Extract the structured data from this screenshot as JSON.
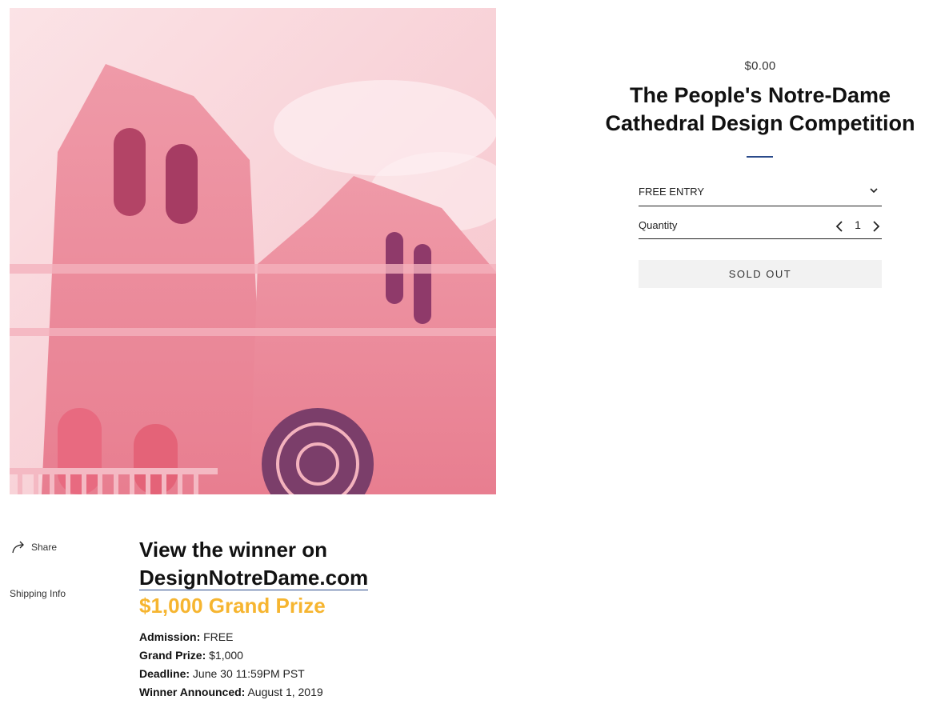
{
  "product": {
    "price": "$0.00",
    "title": "The People's Notre-Dame Cathedral Design Competition",
    "variant_selected": "FREE ENTRY",
    "quantity_label": "Quantity",
    "quantity_value": "1",
    "sold_out_label": "SOLD OUT"
  },
  "image": {
    "subject": "Notre-Dame cathedral facade",
    "tint": "#f5a9b5"
  },
  "sidebar": {
    "share_label": "Share",
    "shipping_label": "Shipping Info"
  },
  "description": {
    "heading_line1": "View the winner on",
    "heading_link": "DesignNotreDame.com",
    "prize_heading": "$1,000 Grand Prize",
    "facts": [
      {
        "key": "Admission:",
        "value": "FREE"
      },
      {
        "key": "Grand Prize:",
        "value": "$1,000"
      },
      {
        "key": "Deadline:",
        "value": "June 30 11:59PM PST"
      },
      {
        "key": "Winner Announced:",
        "value": "August 1, 2019"
      }
    ]
  },
  "colors": {
    "accent_rule": "#2a4a8a",
    "prize_yellow": "#f6b530",
    "button_bg": "#f2f2f2"
  }
}
